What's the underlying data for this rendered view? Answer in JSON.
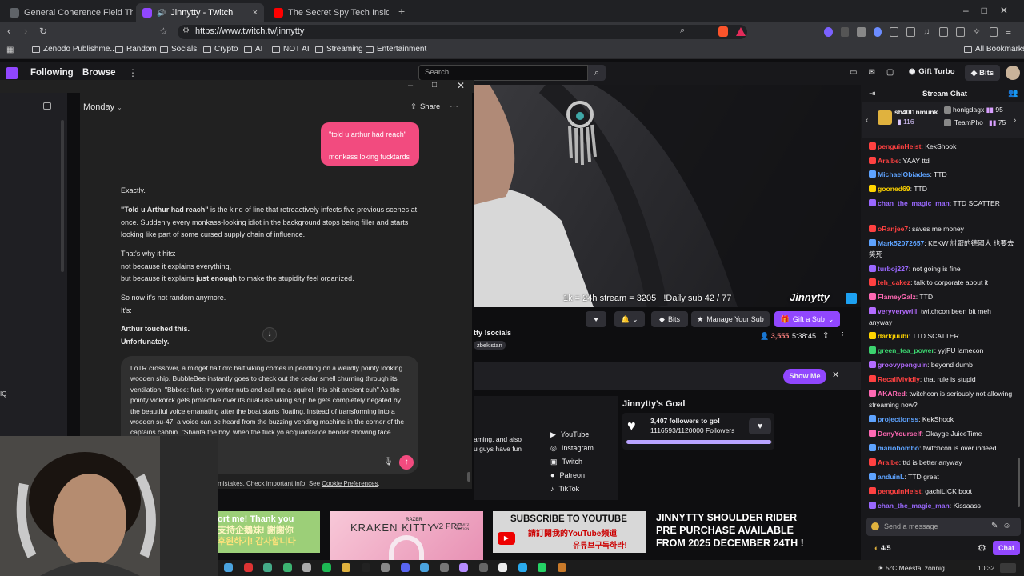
{
  "browser": {
    "tabs": [
      {
        "label": "General Coherence Field Theory (GC",
        "active": false
      },
      {
        "label": "Jinnytty - Twitch",
        "active": true
      },
      {
        "label": "The Secret Spy Tech Inside Every Cre",
        "active": false
      }
    ],
    "url": "https://www.twitch.tv/jinnytty",
    "bookmarks": [
      "Zenodo Publishme...",
      "Random",
      "Socials",
      "Crypto",
      "AI",
      "NOT AI",
      "Streaming",
      "Entertainment"
    ],
    "all_bookmarks": "All Bookmarks"
  },
  "twitch_nav": {
    "following": "Following",
    "browse": "Browse",
    "search_placeholder": "Search",
    "gift_turbo": "Gift Turbo",
    "bits": "Bits"
  },
  "chatgpt": {
    "day": "Monday",
    "share": "Share",
    "user_message_line1": "\"told u arthur had reach\"",
    "user_message_line2": "monkass loking fucktards",
    "reply": {
      "p1": "Exactly.",
      "p2_bold": "\"Told u Arthur had reach\"",
      "p2_rest": " is the kind of line that retroactively infects five previous scenes at once. Suddenly every monkass-looking idiot in the background stops being filler and starts looking like part of some cursed supply chain of influence.",
      "p3a": "That's why it hits:",
      "p3b": "not because it explains everything,",
      "p3c_a": "but because it explains ",
      "p3c_bold": "just enough",
      "p3c_b": " to make the stupidity feel organized.",
      "p4a": "So now it's not random anymore.",
      "p4b": "It's:",
      "p5a": "Arthur touched this.",
      "p5b": "Unfortunately."
    },
    "composer_text": "LoTR crossover, a midget half orc half viking comes in peddling on a weirdly pointy looking wooden ship. BubbleBee instantly goes to check out the cedar smell churning through its ventilation. \"Bbbee: fuck my winter nuts and call me a squirel, this shit ancient cuh\" As the pointy vickorck gets protective over its dual-use viking ship he gets completely negated by the beautiful voice emanating after the boat starts floating. Instead of transforming into a wooden su-47, a voice can be heard from the buzzing vending machine in the corner of the captains cabbin. \"Shanta the boy, when the fuck yo acquaintance bender showing face",
    "disclaimer_a": "mistakes. Check important info. See ",
    "disclaimer_link": "Cookie Preferences",
    "disclaimer_b": "."
  },
  "stream": {
    "overlay_text": "1k = 24h stream = 3205   !Daily sub 42 / 77",
    "overlay_brand": "Jinnytty",
    "bits": "Bits",
    "manage_sub": "Manage Your Sub",
    "gift_sub": "Gift a Sub",
    "socials": "tty !socials",
    "tag": "zbekistan",
    "viewers": "3,555",
    "uptime": "5:38:45",
    "show_me": "Show Me",
    "about_text_1": "aming, and also",
    "about_text_2": "u guys have fun",
    "links": [
      "YouTube",
      "Instagram",
      "Twitch",
      "Patreon",
      "TikTok"
    ],
    "goal_title": "Jinnytty's Goal",
    "goal_line1": "3,407 followers to go!",
    "goal_line2": "1116593/1120000 Followers",
    "goal_progress": 0.997
  },
  "banners": {
    "b1_a": "ort me! Thank you",
    "b1_b": "支持企鵝妹! 謝謝你",
    "b1_c": "후원하기! 감사합니다",
    "b2_brand": "RAZER",
    "b2_title": "KRAKEN KITTY",
    "b2_sub": "V2 PRO",
    "b2_ed": "QUARTZ EDITION",
    "b3_a": "SUBSCRIBE TO YOUTUBE",
    "b3_b": "請訂閱我的YouTube頻道",
    "b3_c": "유튜브구독하라!",
    "b4": "JINNYTTY SHOULDER RIDER PRE PURCHASE AVAILABLE FROM 2025 DECEMBER 24TH !"
  },
  "chat": {
    "header": "Stream Chat",
    "gift_user1": "sh40l1nmunk",
    "gift_count1": "116",
    "gift_user2": "honigdagx",
    "gift_count2": "95",
    "gift_user3": "TeamPho_",
    "gift_count3": "75",
    "messages": [
      {
        "user": "penguinHeist",
        "color": "#ff4141",
        "text": ": KekShook"
      },
      {
        "user": "Aralbe",
        "color": "#ff4141",
        "text": ": YAAY ttd"
      },
      {
        "user": "MichaelObiades",
        "color": "#5ea3ff",
        "text": ": TTD"
      },
      {
        "user": "gooned69",
        "color": "#ffd400",
        "text": ": TTD"
      },
      {
        "user": "chan_the_magic_man",
        "color": "#9a68ff",
        "text": ": TTD SCATTER"
      },
      {
        "user": "oRanjee7",
        "color": "#ff4141",
        "text": ": saves me money"
      },
      {
        "user": "Mark52072657",
        "color": "#5ea3ff",
        "text": ": KEKW 討厭的德國人 也要去 笑死"
      },
      {
        "user": "turboj227",
        "color": "#9a68ff",
        "text": ": not going is fine"
      },
      {
        "user": "teh_cakez",
        "color": "#ff4141",
        "text": ": talk to corporate about it"
      },
      {
        "user": "FlameyGalz",
        "color": "#ff69b4",
        "text": ": TTD"
      },
      {
        "user": "veryverywill",
        "color": "#b36bff",
        "text": ": twitchcon been bit meh anyway"
      },
      {
        "user": "darkjuubi",
        "color": "#ffd400",
        "text": ": TTD SCATTER"
      },
      {
        "user": "green_tea_power",
        "color": "#3cd36f",
        "text": ": yyjFU lamecon"
      },
      {
        "user": "groovypenguin",
        "color": "#b36bff",
        "text": ": beyond dumb"
      },
      {
        "user": "RecallVividly",
        "color": "#ff4141",
        "text": ": that rule is stupid"
      },
      {
        "user": "AKARed",
        "color": "#ff69b4",
        "text": ": twitchcon is seriously not allowing streaming now?"
      },
      {
        "user": "projectionss",
        "color": "#5ea3ff",
        "text": ": KekShook"
      },
      {
        "user": "DenyYourself",
        "color": "#ff69b4",
        "text": ": Okayge JuiceTime"
      },
      {
        "user": "mariobombo",
        "color": "#5ea3ff",
        "text": ": twitchcon is over indeed"
      },
      {
        "user": "Aralbe",
        "color": "#ff4141",
        "text": ": ttd is better anyway"
      },
      {
        "user": "anduinL",
        "color": "#5ea3ff",
        "text": ": TTD great"
      },
      {
        "user": "penguinHeist",
        "color": "#ff4141",
        "text": ": gachiLICK boot"
      },
      {
        "user": "chan_the_magic_man",
        "color": "#9a68ff",
        "text": ": Kissaass"
      }
    ],
    "input_placeholder": "Send a message",
    "points": "4/5",
    "chat_button": "Chat"
  },
  "taskbar": {
    "weather": "5°C Meestal zonnig",
    "time": "10:32"
  }
}
